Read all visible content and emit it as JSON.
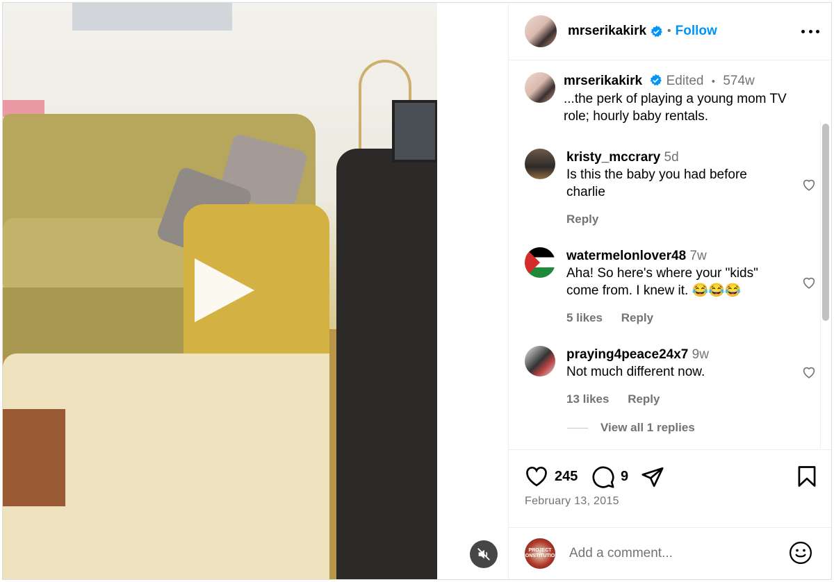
{
  "post": {
    "author": "mrserikakirk",
    "follow_label": "Follow",
    "header_dot": "•",
    "caption": {
      "author": "mrserikakirk",
      "edited_label": "Edited",
      "dot": "•",
      "age": "574w",
      "text": "...the perk of playing a young mom TV role; hourly baby rentals."
    }
  },
  "comments": [
    {
      "user": "kristy_mccrary",
      "age": "5d",
      "text": "Is this the baby you had before charlie",
      "likes": "",
      "reply_label": "Reply"
    },
    {
      "user": "watermelonlover48",
      "age": "7w",
      "text": "Aha! So here's where your \"kids\" come from. I knew it. 😂😂😂",
      "likes": "5 likes",
      "reply_label": "Reply"
    },
    {
      "user": "praying4peace24x7",
      "age": "9w",
      "text": "Not much different now.",
      "likes": "13 likes",
      "reply_label": "Reply"
    }
  ],
  "view_replies": "View all 1 replies",
  "actions": {
    "like_count": "245",
    "comment_count": "9"
  },
  "date": "February 13, 2015",
  "add_comment": {
    "placeholder": "Add a comment...",
    "avatar_text": "PROJECT CONSTITUTION"
  },
  "icons": {
    "verified": "verified-badge-icon",
    "more": "more-options-icon",
    "heart": "heart-icon",
    "comment": "comment-icon",
    "share": "share-icon",
    "save": "bookmark-icon",
    "emoji": "emoji-icon",
    "play": "play-icon",
    "mute": "muted-icon"
  },
  "colors": {
    "follow": "#0095f6",
    "verified": "#0095f6",
    "muted_text": "#737373"
  }
}
